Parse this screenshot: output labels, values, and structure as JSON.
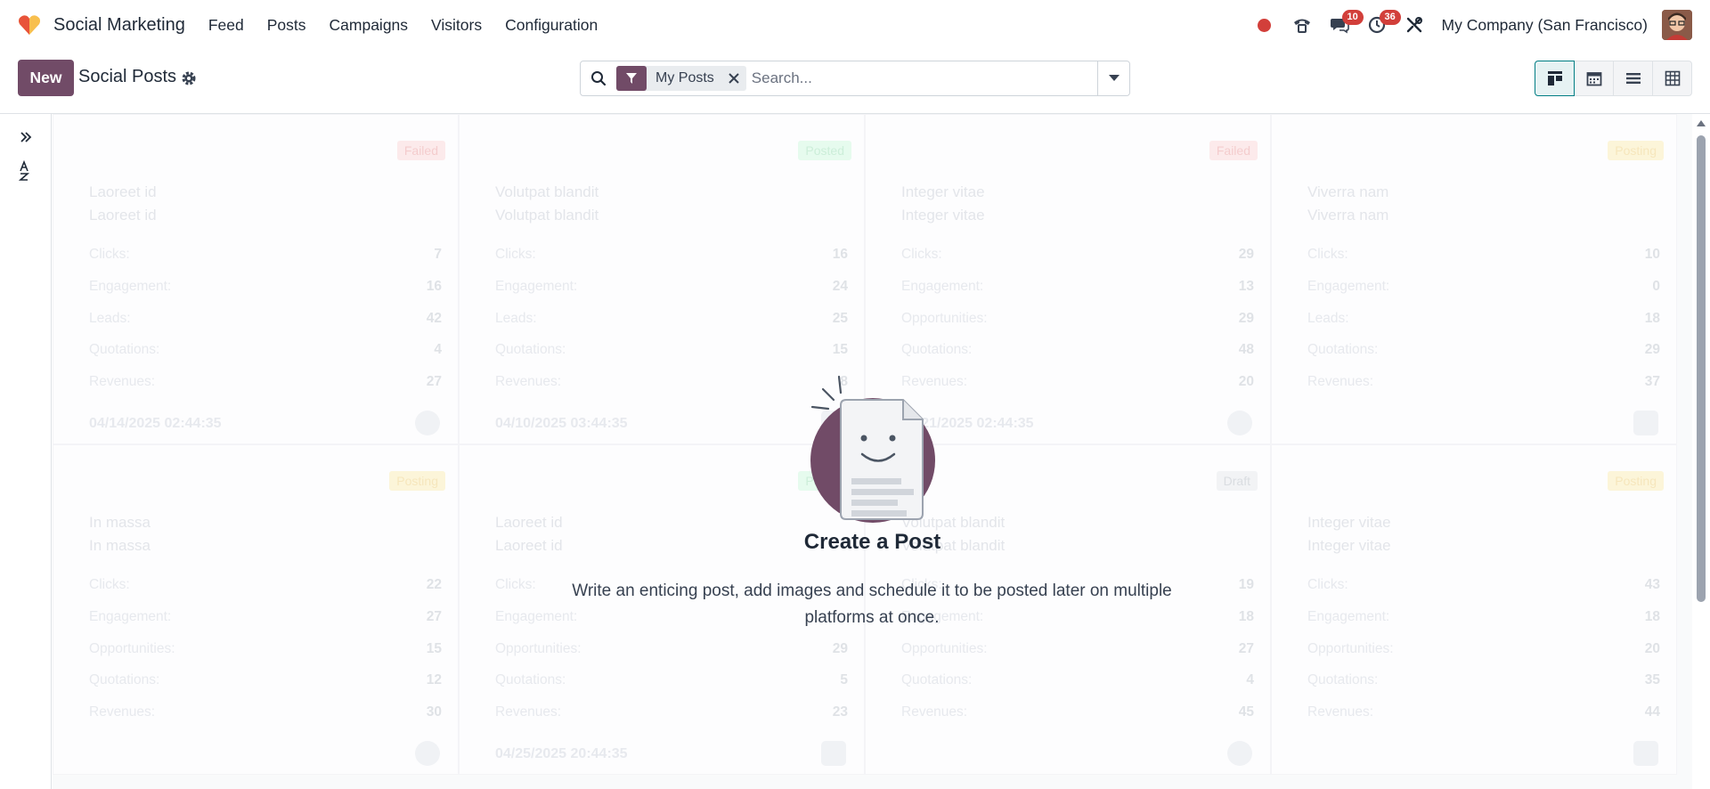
{
  "app": {
    "name": "Social Marketing",
    "menu": [
      {
        "label": "Feed"
      },
      {
        "label": "Posts"
      },
      {
        "label": "Campaigns"
      },
      {
        "label": "Visitors"
      },
      {
        "label": "Configuration"
      }
    ],
    "accent_color": "#714b67"
  },
  "systray": {
    "messages_count": "10",
    "activities_count": "36",
    "company": "My Company (San Francisco)"
  },
  "control_panel": {
    "new_label": "New",
    "breadcrumb": "Social Posts",
    "search": {
      "facet_label": "My Posts",
      "placeholder": "Search..."
    },
    "views": [
      "kanban",
      "calendar",
      "list",
      "pivot"
    ],
    "active_view": "kanban"
  },
  "kanban": {
    "cards": [
      {
        "status": "Failed",
        "status_kind": "failed",
        "title": "Laoreet id",
        "subtitle": "Laoreet id",
        "stats": [
          {
            "label": "Clicks:",
            "value": "7"
          },
          {
            "label": "Engagement:",
            "value": "16"
          },
          {
            "label": "Leads:",
            "value": "42"
          },
          {
            "label": "Quotations:",
            "value": "4"
          },
          {
            "label": "Revenues:",
            "value": "27"
          }
        ],
        "date": "04/14/2025 02:44:35"
      },
      {
        "status": "Posted",
        "status_kind": "posted",
        "title": "Volutpat blandit",
        "subtitle": "Volutpat blandit",
        "stats": [
          {
            "label": "Clicks:",
            "value": "16"
          },
          {
            "label": "Engagement:",
            "value": "24"
          },
          {
            "label": "Leads:",
            "value": "25"
          },
          {
            "label": "Quotations:",
            "value": "15"
          },
          {
            "label": "Revenues:",
            "value": "8"
          }
        ],
        "date": "04/10/2025 03:44:35"
      },
      {
        "status": "Failed",
        "status_kind": "failed",
        "title": "Integer vitae",
        "subtitle": "Integer vitae",
        "stats": [
          {
            "label": "Clicks:",
            "value": "29"
          },
          {
            "label": "Engagement:",
            "value": "13"
          },
          {
            "label": "Opportunities:",
            "value": "29"
          },
          {
            "label": "Quotations:",
            "value": "48"
          },
          {
            "label": "Revenues:",
            "value": "20"
          }
        ],
        "date": "04/21/2025 02:44:35"
      },
      {
        "status": "Posting",
        "status_kind": "posting",
        "title": "Viverra nam",
        "subtitle": "Viverra nam",
        "stats": [
          {
            "label": "Clicks:",
            "value": "10"
          },
          {
            "label": "Engagement:",
            "value": "0"
          },
          {
            "label": "Leads:",
            "value": "18"
          },
          {
            "label": "Quotations:",
            "value": "29"
          },
          {
            "label": "Revenues:",
            "value": "37"
          }
        ],
        "date": ""
      },
      {
        "status": "Posting",
        "status_kind": "posting",
        "title": "In massa",
        "subtitle": "In massa",
        "stats": [
          {
            "label": "Clicks:",
            "value": "22"
          },
          {
            "label": "Engagement:",
            "value": "27"
          },
          {
            "label": "Opportunities:",
            "value": "15"
          },
          {
            "label": "Quotations:",
            "value": "12"
          },
          {
            "label": "Revenues:",
            "value": "30"
          }
        ],
        "date": ""
      },
      {
        "status": "Posted",
        "status_kind": "posted",
        "title": "Laoreet id",
        "subtitle": "Laoreet id",
        "stats": [
          {
            "label": "Clicks:",
            "value": ""
          },
          {
            "label": "Engagement:",
            "value": ""
          },
          {
            "label": "Opportunities:",
            "value": "29"
          },
          {
            "label": "Quotations:",
            "value": "5"
          },
          {
            "label": "Revenues:",
            "value": "23"
          }
        ],
        "date": "04/25/2025 20:44:35"
      },
      {
        "status": "Draft",
        "status_kind": "draft",
        "title": "Volutpat blandit",
        "subtitle": "Volutpat blandit",
        "stats": [
          {
            "label": "Clicks:",
            "value": "19"
          },
          {
            "label": "Engagement:",
            "value": "18"
          },
          {
            "label": "Opportunities:",
            "value": "27"
          },
          {
            "label": "Quotations:",
            "value": "4"
          },
          {
            "label": "Revenues:",
            "value": "45"
          }
        ],
        "date": ""
      },
      {
        "status": "Posting",
        "status_kind": "posting",
        "title": "Integer vitae",
        "subtitle": "Integer vitae",
        "stats": [
          {
            "label": "Clicks:",
            "value": "43"
          },
          {
            "label": "Engagement:",
            "value": "18"
          },
          {
            "label": "Opportunities:",
            "value": "20"
          },
          {
            "label": "Quotations:",
            "value": "35"
          },
          {
            "label": "Revenues:",
            "value": "44"
          }
        ],
        "date": ""
      }
    ]
  },
  "empty_helper": {
    "title": "Create a Post",
    "description": "Write an enticing post, add images and schedule it to be posted later on multiple platforms at once."
  }
}
